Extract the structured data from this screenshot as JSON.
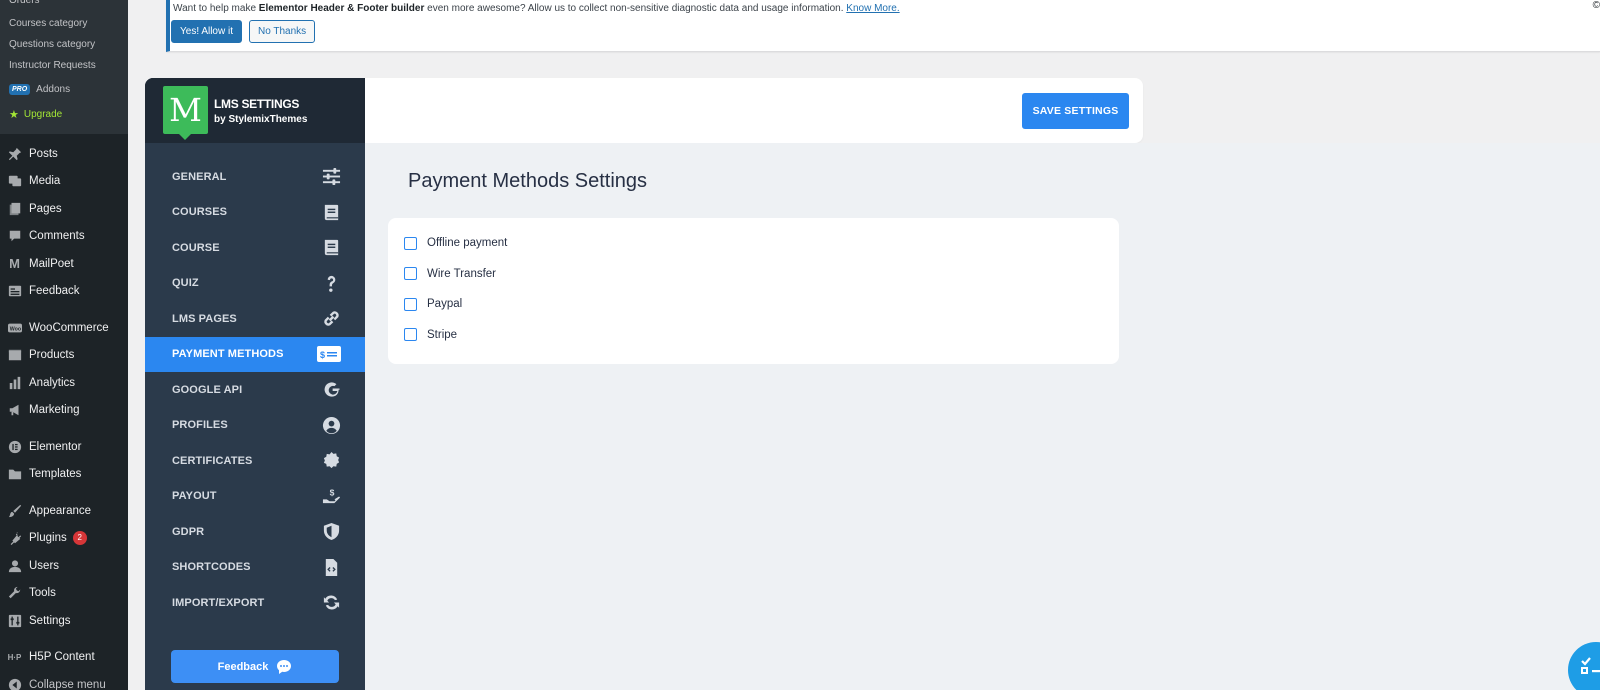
{
  "wp_sidebar": {
    "submenu": [
      "Orders",
      "Courses category",
      "Questions category",
      "Instructor Requests"
    ],
    "addons": {
      "badge": "PRO",
      "label": "Addons"
    },
    "upgrade": "Upgrade",
    "groups": [
      [
        {
          "label": "Posts",
          "icon": "pin-icon"
        },
        {
          "label": "Media",
          "icon": "media-icon"
        },
        {
          "label": "Pages",
          "icon": "pages-icon"
        },
        {
          "label": "Comments",
          "icon": "comments-icon"
        },
        {
          "label": "MailPoet",
          "icon": "mailpoet-icon"
        },
        {
          "label": "Feedback",
          "icon": "feedback-icon"
        }
      ],
      [
        {
          "label": "WooCommerce",
          "icon": "woocommerce-icon"
        },
        {
          "label": "Products",
          "icon": "products-icon"
        },
        {
          "label": "Analytics",
          "icon": "analytics-icon"
        },
        {
          "label": "Marketing",
          "icon": "marketing-icon"
        }
      ],
      [
        {
          "label": "Elementor",
          "icon": "elementor-icon"
        },
        {
          "label": "Templates",
          "icon": "templates-icon"
        }
      ],
      [
        {
          "label": "Appearance",
          "icon": "appearance-icon"
        },
        {
          "label": "Plugins",
          "icon": "plugins-icon",
          "badge": "2"
        },
        {
          "label": "Users",
          "icon": "users-icon"
        },
        {
          "label": "Tools",
          "icon": "tools-icon"
        },
        {
          "label": "Settings",
          "icon": "settings-icon"
        }
      ],
      [
        {
          "label": "H5P Content",
          "icon": "h5p-icon"
        },
        {
          "label": "Collapse menu",
          "icon": "collapse-icon"
        }
      ]
    ]
  },
  "notice": {
    "text_before": "Want to help make ",
    "text_bold": "Elementor Header & Footer builder",
    "text_after": " even more awesome? Allow us to collect non-sensitive diagnostic data and usage information. ",
    "link": "Know More.",
    "yes_label": "Yes! Allow it",
    "no_label": "No Thanks",
    "edge": "©"
  },
  "lms": {
    "logo_letter": "M",
    "brand_title": "LMS SETTINGS",
    "brand_sub": "by StylemixThemes",
    "menu": [
      {
        "label": "GENERAL",
        "icon": "sliders-icon",
        "active": false
      },
      {
        "label": "COURSES",
        "icon": "book-icon",
        "active": false
      },
      {
        "label": "COURSE",
        "icon": "book-icon",
        "active": false
      },
      {
        "label": "QUIZ",
        "icon": "question-icon",
        "active": false
      },
      {
        "label": "LMS PAGES",
        "icon": "link-icon",
        "active": false
      },
      {
        "label": "PAYMENT METHODS",
        "icon": "payment-icon",
        "active": true
      },
      {
        "label": "GOOGLE API",
        "icon": "google-icon",
        "active": false
      },
      {
        "label": "PROFILES",
        "icon": "user-circle-icon",
        "active": false
      },
      {
        "label": "CERTIFICATES",
        "icon": "certificate-icon",
        "active": false
      },
      {
        "label": "PAYOUT",
        "icon": "payout-icon",
        "active": false
      },
      {
        "label": "GDPR",
        "icon": "shield-icon",
        "active": false
      },
      {
        "label": "SHORTCODES",
        "icon": "code-file-icon",
        "active": false
      },
      {
        "label": "IMPORT/EXPORT",
        "icon": "sync-icon",
        "active": false
      }
    ],
    "feedback_label": "Feedback",
    "save_label": "SAVE SETTINGS",
    "page_title": "Payment Methods Settings",
    "methods": [
      {
        "label": "Offline payment",
        "checked": false
      },
      {
        "label": "Wire Transfer",
        "checked": false
      },
      {
        "label": "Paypal",
        "checked": false
      },
      {
        "label": "Stripe",
        "checked": false
      }
    ]
  },
  "colors": {
    "wp_sidebar_bg": "#1d2327",
    "lms_nav_bg": "#2b3a4b",
    "accent_blue": "#2b87f0",
    "logo_green": "#3dbb5a",
    "content_bg": "#eef1f4"
  }
}
